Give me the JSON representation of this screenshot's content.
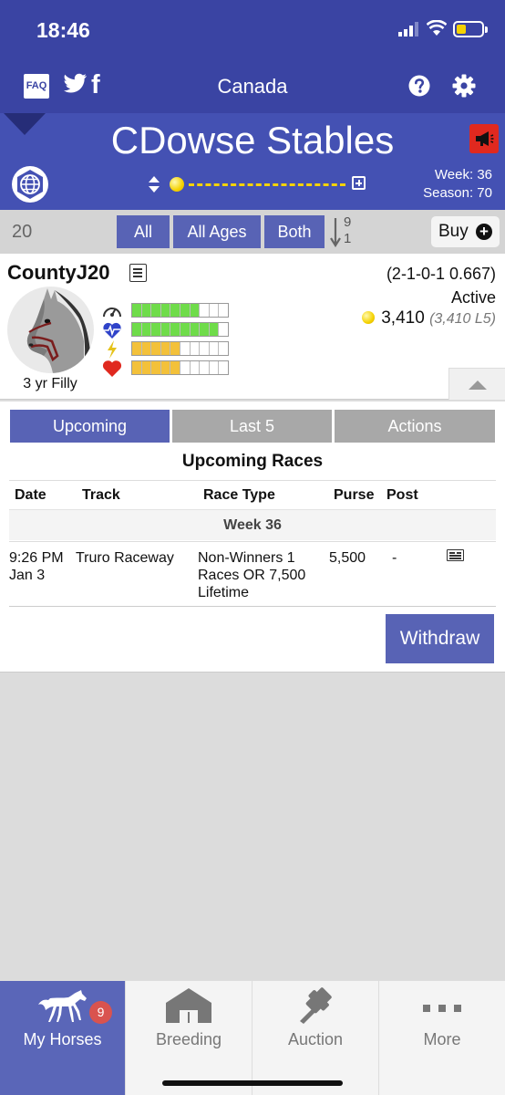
{
  "status_bar": {
    "time": "18:46"
  },
  "nav": {
    "title": "Canada",
    "faq_label": "FAQ"
  },
  "stable": {
    "name": "CDowse Stables",
    "week": "Week: 36",
    "season": "Season: 70"
  },
  "filters": {
    "count": "20",
    "buttons": [
      "All",
      "All Ages",
      "Both"
    ],
    "sort_top": "9",
    "sort_bottom": "1",
    "buy_label": "Buy"
  },
  "horse": {
    "name": "CountyJ20",
    "age_sex": "3 yr Filly",
    "record": "(2-1-0-1 0.667)",
    "status": "Active",
    "earnings": "3,410",
    "earnings_l5": "(3,410 L5)",
    "stats": [
      {
        "icon": "speedometer-icon",
        "level": 0.7,
        "color": "#6fdc4a"
      },
      {
        "icon": "heartbeat-icon",
        "level": 0.9,
        "color": "#6fdc4a"
      },
      {
        "icon": "lightning-icon",
        "level": 0.5,
        "color": "#f3c13a"
      },
      {
        "icon": "heart-icon",
        "level": 0.5,
        "color": "#f3c13a"
      }
    ]
  },
  "tabs": {
    "upcoming": "Upcoming",
    "last5": "Last 5",
    "actions": "Actions"
  },
  "races": {
    "title": "Upcoming Races",
    "headers": {
      "date": "Date",
      "track": "Track",
      "race_type": "Race Type",
      "purse": "Purse",
      "post": "Post"
    },
    "week_label": "Week 36",
    "rows": [
      {
        "date_time": "9:26 PM",
        "date_day": "Jan 3",
        "track": "Truro Raceway",
        "race_type_1": "Non-Winners 1",
        "race_type_2": "Races OR 7,500",
        "race_type_3": "Lifetime",
        "purse": "5,500",
        "post": "-"
      }
    ],
    "withdraw_label": "Withdraw"
  },
  "tabbar": {
    "items": [
      "My Horses",
      "Breeding",
      "Auction",
      "More"
    ],
    "badge": "9"
  },
  "colors": {
    "primary": "#3a44a3",
    "accent": "#5863b5",
    "stat_green": "#6fdc4a",
    "stat_yellow": "#f3c13a"
  }
}
